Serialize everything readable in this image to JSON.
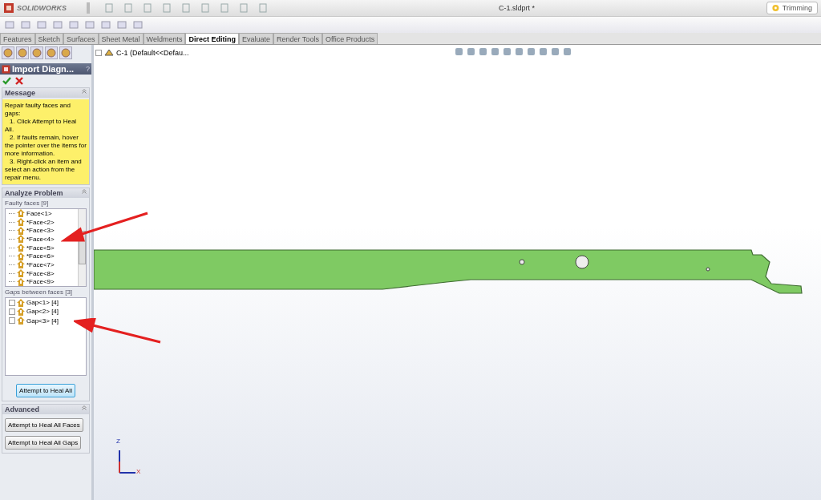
{
  "app": {
    "logo": "SOLIDWORKS"
  },
  "window": {
    "title": "C-1.sldprt *"
  },
  "help_search": {
    "value": "Trimming"
  },
  "tabs": [
    {
      "label": "Features",
      "selected": false
    },
    {
      "label": "Sketch",
      "selected": false
    },
    {
      "label": "Surfaces",
      "selected": false
    },
    {
      "label": "Sheet Metal",
      "selected": false
    },
    {
      "label": "Weldments",
      "selected": false
    },
    {
      "label": "Direct Editing",
      "selected": true
    },
    {
      "label": "Evaluate",
      "selected": false
    },
    {
      "label": "Render Tools",
      "selected": false
    },
    {
      "label": "Office Products",
      "selected": false
    }
  ],
  "feature_tree": {
    "root": "C-1  (Default<<Defau..."
  },
  "property_manager": {
    "title": "Import Diagn...",
    "help": "?",
    "message": {
      "title": "Message",
      "lines": [
        "Repair faulty faces and gaps:",
        "1. Click Attempt to Heal All.",
        "2. If faults remain, hover the pointer over the items for more information.",
        "3. Right-click an item and select an action from the repair menu."
      ]
    },
    "analyze": {
      "title": "Analyze Problem",
      "faces_label": "Faulty faces [9]",
      "faces": [
        "Face<1>",
        "*Face<2>",
        "*Face<3>",
        "*Face<4>",
        "*Face<5>",
        "*Face<6>",
        "*Face<7>",
        "*Face<8>",
        "*Face<9>"
      ],
      "gaps_label": "Gaps between faces [3]",
      "gaps": [
        "Gap<1> [4]",
        "Gap<2> [4]",
        "Gap<3> [4]"
      ],
      "heal_button": "Attempt to Heal All"
    },
    "advanced": {
      "title": "Advanced",
      "buttons": [
        "Attempt to Heal All Faces",
        "Attempt to Heal All Gaps"
      ]
    }
  },
  "axes": {
    "z": "Z",
    "x": "X"
  }
}
